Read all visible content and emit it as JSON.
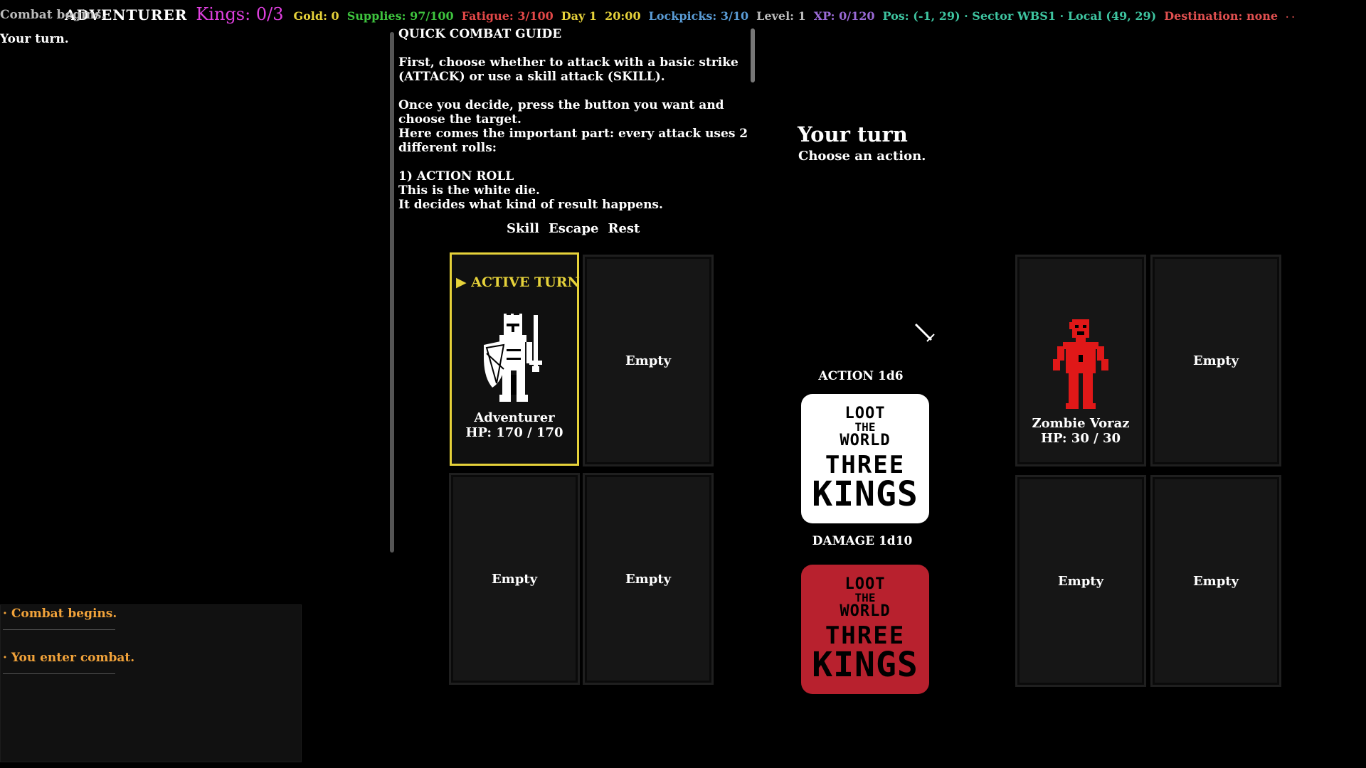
{
  "hud": {
    "title": "ADVENTURER",
    "kings": "Kings: 0/3",
    "gold": "Gold: 0",
    "supplies": "Supplies: 97/100",
    "fatigue": "Fatigue: 3/100",
    "day": "Day 1  20:00",
    "lockpicks": "Lockpicks: 3/10",
    "level": "Level: 1",
    "xp": "XP: 0/120",
    "pos": "Pos: (-1, 29) · Sector WBS1 · Local (49, 29)",
    "destination": "Destination: none",
    "dots": "· ·"
  },
  "top_log": {
    "clipped_line": "Combat begins.",
    "line": "Your turn."
  },
  "guide": {
    "heading": "QUICK COMBAT GUIDE",
    "p1": "First, choose whether to attack with a basic strike (ATTACK) or use a skill attack (SKILL).",
    "p2": "Once you decide, press the button you want and choose the target.\nHere comes the important part: every attack uses 2 different rolls:",
    "p3": "1) ACTION ROLL\nThis is the white die.\nIt decides what kind of result happens."
  },
  "actions": [
    "Skill",
    "Escape",
    "Rest"
  ],
  "turn": {
    "title": "Your turn",
    "subtitle": "Choose an action."
  },
  "player_slots": {
    "active_label": "▶ ACTIVE TURN",
    "hero_name": "Adventurer",
    "hero_hp": "HP: 170 / 170",
    "empty": "Empty"
  },
  "enemy_slots": {
    "enemy_name": "Zombie Voraz",
    "enemy_hp": "HP: 30 / 30",
    "empty": "Empty"
  },
  "dice": {
    "action_label": "ACTION 1d6",
    "damage_label": "DAMAGE 1d10",
    "face": {
      "l1": "LOOT",
      "l2": "THE",
      "l3": "WORLD",
      "l4": "THREE",
      "l5": "KINGS"
    },
    "action_color": "#ffffff",
    "damage_color": "#b8212e"
  },
  "message_log": [
    "· Combat begins.",
    "· You enter combat."
  ],
  "colors": {
    "accent_yellow": "#e6d23a",
    "kings_magenta": "#e040e0",
    "log_orange": "#f2a33a",
    "enemy_red": "#e01818"
  }
}
